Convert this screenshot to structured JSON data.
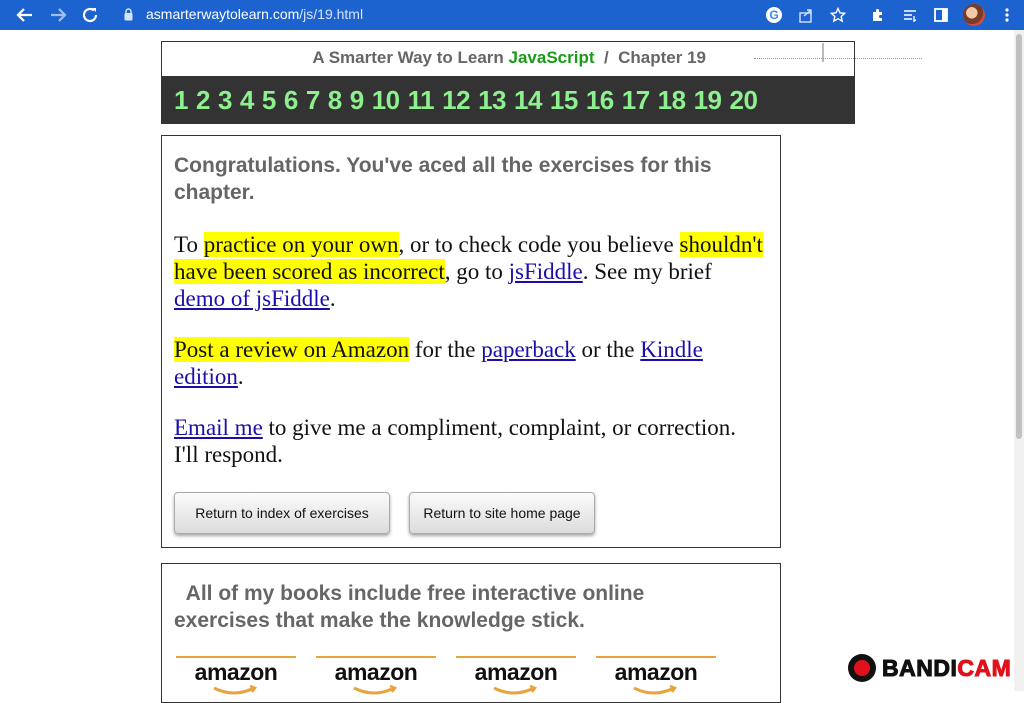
{
  "browser": {
    "url_host": "asmarterwaytolearn.com",
    "url_path": "/js/19.html",
    "icons": [
      "back-icon",
      "forward-icon",
      "reload-icon",
      "lock-icon",
      "google-icon",
      "share-icon",
      "star-icon",
      "extensions-icon",
      "reading-list-icon",
      "side-panel-icon",
      "avatar",
      "menu-icon"
    ]
  },
  "header": {
    "title_prefix": "A Smarter Way to Learn ",
    "title_js": "JavaScript",
    "title_suffix": "  /  Chapter 19",
    "chapters": [
      "1",
      "2",
      "3",
      "4",
      "5",
      "6",
      "7",
      "8",
      "9",
      "10",
      "11",
      "12",
      "13",
      "14",
      "15",
      "16",
      "17",
      "18",
      "19",
      "20"
    ]
  },
  "main": {
    "congrats": "Congratulations. You've aced all the exercises for this chapter.",
    "p1": {
      "t1": "To ",
      "hl1": "practice on your own",
      "t2": ", or to check code you believe ",
      "hl2": "shouldn't have been scored as incorrect",
      "t3": ", go to ",
      "link1": "jsFiddle",
      "t4": ". See my brief ",
      "link2": "demo of jsFiddle",
      "t5": "."
    },
    "p2": {
      "hl": "Post a review on Amazon",
      "t1": " for the ",
      "link1": "paperback",
      "t2": " or the ",
      "link2": "Kindle edition",
      "t3": "."
    },
    "p3": {
      "link": "Email me",
      "t1": " to give me a compliment, complaint, or correction. I'll respond."
    },
    "buttons": {
      "index": "Return to index of exercises",
      "home": "Return to site home page"
    }
  },
  "books": {
    "text": "All of my books include free interactive online exercises that make the knowledge stick.",
    "logos": [
      "amazon",
      "amazon",
      "amazon",
      "amazon"
    ]
  },
  "watermark": {
    "bandi": "BANDI",
    "cam": "CAM"
  },
  "colors": {
    "chrome": "#1c63cf",
    "highlight": "#ffff00",
    "chapter_bar": "#333333",
    "chapter_text": "#8ef08e",
    "javascript_green": "#1a9b1a",
    "link": "#1a0dab"
  }
}
